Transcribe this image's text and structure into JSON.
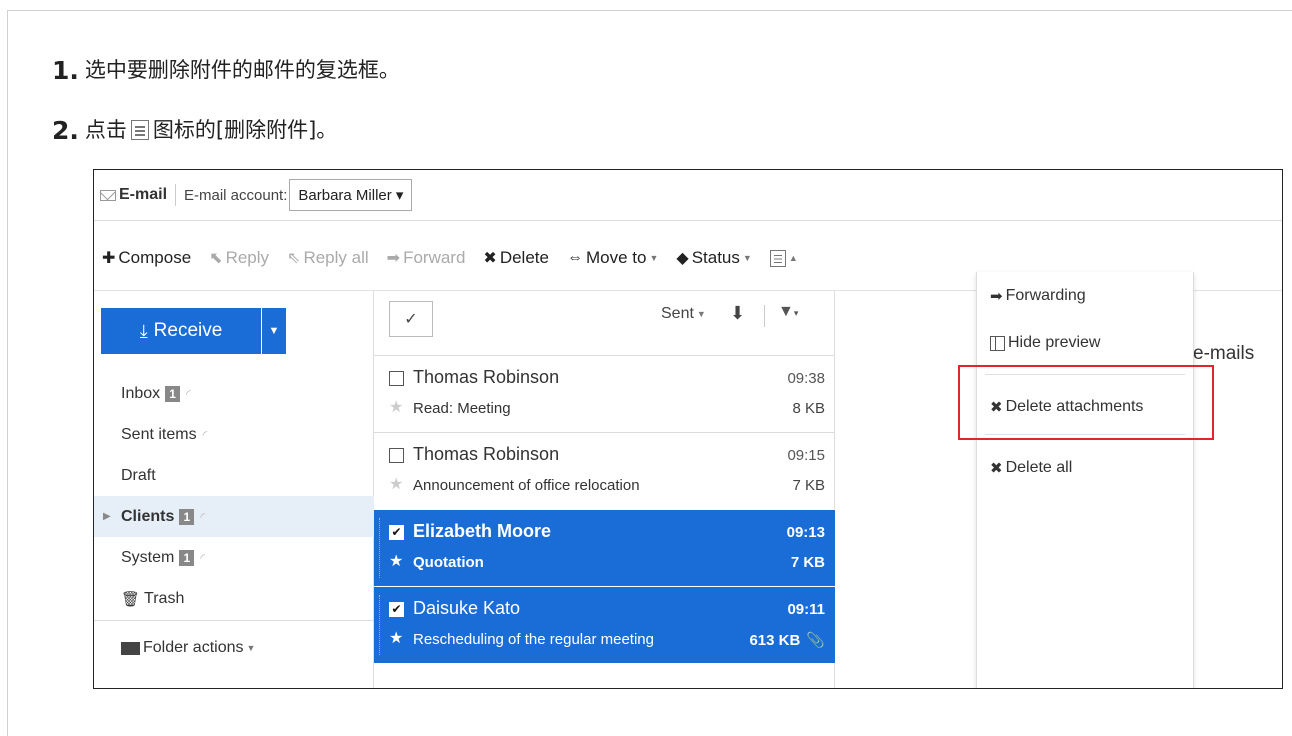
{
  "instructions": {
    "step1": {
      "num": "1.",
      "text": "选中要删除附件的邮件的复选框。"
    },
    "step2": {
      "num": "2.",
      "text_before": "点击",
      "text_after": "图标的[删除附件]。"
    }
  },
  "header": {
    "title": "E-mail",
    "account_label": "E-mail account:",
    "account_value": "Barbara Miller"
  },
  "toolbar": {
    "compose": "Compose",
    "reply": "Reply",
    "reply_all": "Reply all",
    "forward": "Forward",
    "delete": "Delete",
    "move_to": "Move to",
    "status": "Status"
  },
  "sidebar": {
    "receive": "Receive",
    "folders": [
      {
        "label": "Inbox",
        "badge": "1"
      },
      {
        "label": "Sent items"
      },
      {
        "label": "Draft"
      },
      {
        "label": "Clients",
        "badge": "1"
      },
      {
        "label": "System",
        "badge": "1"
      },
      {
        "label": "Trash"
      }
    ],
    "folder_actions": "Folder actions"
  },
  "list": {
    "sort_label": "Sent",
    "messages": [
      {
        "from": "Thomas Robinson",
        "time": "09:38",
        "subject": "Read: Meeting",
        "size": "8 KB",
        "checked": false
      },
      {
        "from": "Thomas Robinson",
        "time": "09:15",
        "subject": "Announcement of office relocation",
        "size": "7 KB",
        "checked": false
      },
      {
        "from": "Elizabeth Moore",
        "time": "09:13",
        "subject": "Quotation",
        "size": "7 KB",
        "checked": true
      },
      {
        "from": "Daisuke Kato",
        "time": "09:11",
        "subject": "Rescheduling of the regular meeting",
        "size": "613 KB",
        "checked": true
      }
    ]
  },
  "preview": {
    "partial_text": "e-mails"
  },
  "menu": {
    "forwarding": "Forwarding",
    "hide_preview": "Hide preview",
    "delete_attachments": "Delete attachments",
    "delete_all": "Delete all"
  },
  "colors": {
    "accent": "#1a6dd6",
    "highlight": "#e0252b"
  }
}
